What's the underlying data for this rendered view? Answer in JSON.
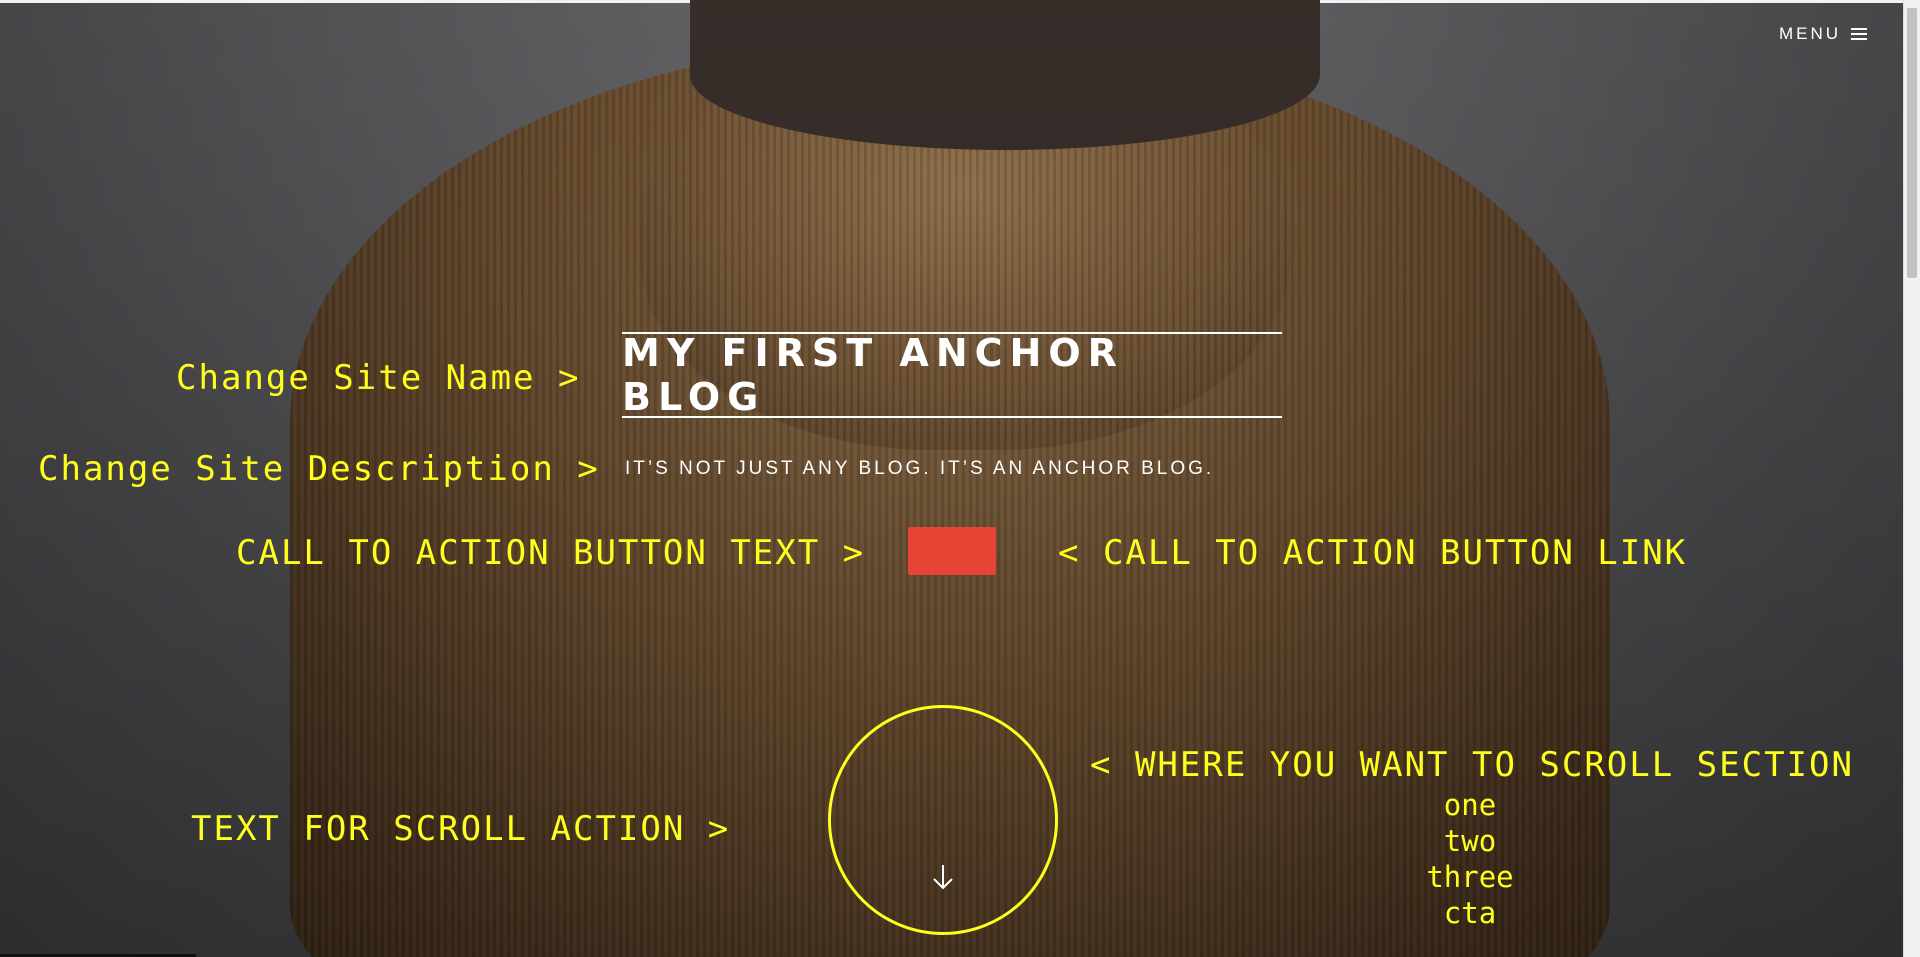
{
  "header": {
    "menu_label": "MENU"
  },
  "site": {
    "title": "MY FIRST ANCHOR BLOG",
    "description": "IT’S NOT JUST ANY BLOG. IT’S AN ANCHOR BLOG."
  },
  "annotations": {
    "site_name": "Change  Site Name >",
    "site_description": "Change Site Description >",
    "cta_text": "CALL TO ACTION BUTTON TEXT >",
    "cta_link": "< CALL TO ACTION BUTTON LINK",
    "scroll_target": "< WHERE YOU WANT TO SCROLL SECTION",
    "scroll_text": "TEXT FOR SCROLL ACTION >"
  },
  "scroll_options": [
    "one",
    "two",
    "three",
    "cta"
  ],
  "cta_button": {
    "label": "",
    "color": "#e84436"
  },
  "colors": {
    "annotation": "#ffff1e",
    "accent": "#e84436",
    "text": "#ffffff"
  },
  "icons": {
    "menu": "hamburger-icon",
    "scroll": "arrow-down-icon"
  }
}
